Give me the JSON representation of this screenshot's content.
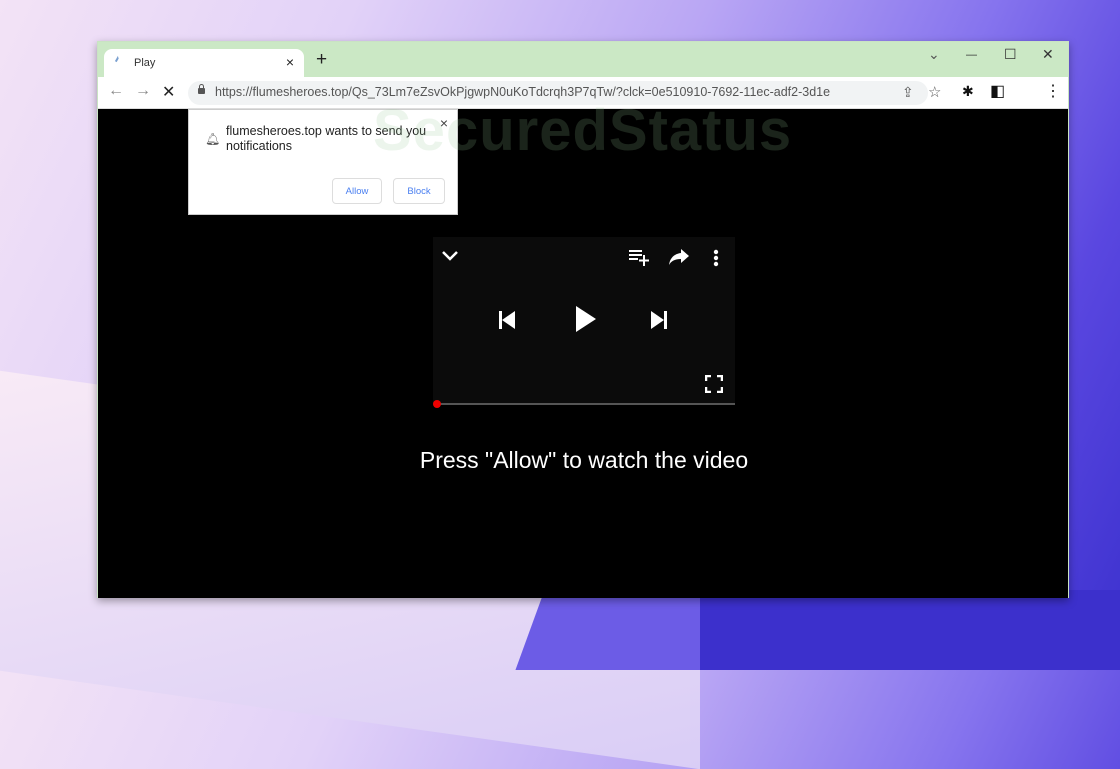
{
  "browser": {
    "tab": {
      "title": "Play",
      "close": "×"
    },
    "new_tab": "+",
    "window_controls": {
      "tab_search": "⌄",
      "minimize": "—",
      "maximize": "☐",
      "close": "✕"
    },
    "nav": {
      "back": "←",
      "forward": "→",
      "stop": "✕"
    },
    "url": "https://flumesheroes.top/Qs_73Lm7eZsvOkPjgwpN0uKoTdcrqh3P7qTw/?clck=0e510910-7692-11ec-adf2-3d1e",
    "omnibox_icons": {
      "share": "⇪",
      "bookmark": "☆"
    },
    "toolbar_icons": {
      "extensions": "✱",
      "side_panel": "◧",
      "menu": "⋮"
    }
  },
  "notification_prompt": {
    "message": "flumesheroes.top wants to send you notifications",
    "close": "×",
    "allow_label": "Allow",
    "block_label": "Block"
  },
  "player": {
    "icons": {
      "collapse": "⌄",
      "add_to_queue": "≡+",
      "share": "➦",
      "more": "⋮",
      "previous": "⏮",
      "play": "▶",
      "next": "⏭",
      "fullscreen": "⛶"
    },
    "progress": 0
  },
  "page": {
    "cta_text": "Press \"Allow\" to watch the video"
  },
  "watermark": "SecuredStatus"
}
